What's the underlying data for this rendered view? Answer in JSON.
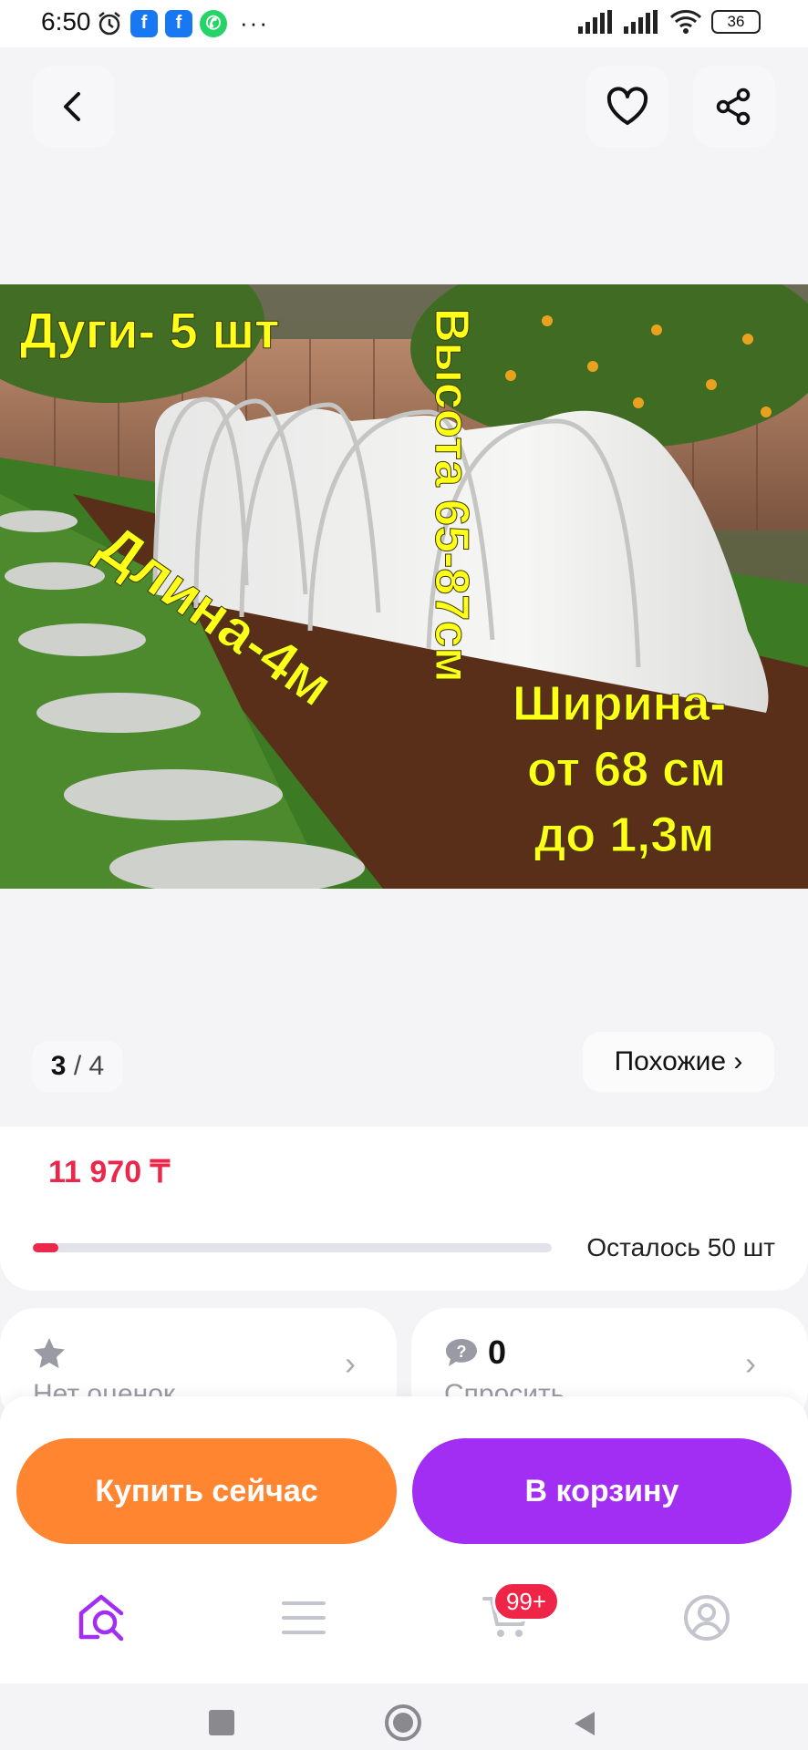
{
  "status_bar": {
    "time": "6:50",
    "battery": "36"
  },
  "header": {
    "back_icon": "chevron-left-icon",
    "favorite_icon": "heart-icon",
    "share_icon": "share-icon"
  },
  "image": {
    "overlay_texts": {
      "arcs": "Дуги- 5 шт",
      "height": "Высота 65-87см",
      "length": "Длина-4м",
      "width_1": "Ширина-",
      "width_2": "от 68 см",
      "width_3": "до 1,3м"
    },
    "counter_current": "3",
    "counter_total": "/ 4",
    "similar_label": "Похожие ›"
  },
  "product": {
    "price": "11 970 ₸",
    "stock_fraction": 0.05,
    "stock_text": "Осталось 50 шт"
  },
  "info_cards": {
    "rating_label": "Нет оценок",
    "questions_count": "0",
    "questions_label": "Спросить"
  },
  "actions": {
    "buy_now": "Купить сейчас",
    "add_to_cart": "В корзину"
  },
  "tabbar": {
    "cart_badge": "99+",
    "colors": {
      "active": "#a22ef4",
      "inactive": "#c4c4cc"
    }
  },
  "colors": {
    "price": "#e9284b",
    "buy_button": "#ff8530",
    "cart_button": "#a22ef4"
  }
}
